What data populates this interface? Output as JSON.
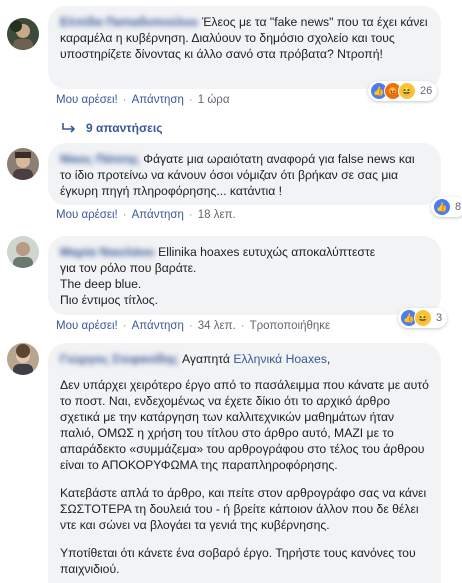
{
  "comments": [
    {
      "text": "Έλεος με τα \"fake news\" που τα έχει κάνει καραμέλα η κυβέρνηση. Διαλύουν το δημόσιο σχολείο και τους υποστηρίζετε δίνοντας κι άλλο σανό στα πρόβατα? Ντροπή!",
      "like": "Μου αρέσει!",
      "reply": "Απάντηση",
      "time": "1 ώρα",
      "reaction_count": "26",
      "replies_label": "9 απαντήσεις",
      "reactions": [
        "like",
        "angry",
        "haha"
      ]
    },
    {
      "text": "Φάγατε μια ωραιότατη αναφορά για false news και το ίδιο προτείνω να κάνουν όσοι νόμιζαν ότι βρήκαν σε σας μια έγκυρη πηγή πληροφόρησης... κατάντια !",
      "like": "Μου αρέσει!",
      "reply": "Απάντηση",
      "time": "18 λεπ.",
      "reaction_count": "8",
      "reactions": [
        "like"
      ]
    },
    {
      "text_lines": [
        "Ellinika hoaxes ευτυχώς αποκαλύπτεστε",
        "για τον ρόλο που βαράτε.",
        "The deep blue.",
        "Πιο έντιμος τίτλος."
      ],
      "like": "Μου αρέσει!",
      "reply": "Απάντηση",
      "time": "34 λεπ.",
      "edited": "Τροποποιήθηκε",
      "reaction_count": "3",
      "reactions": [
        "like",
        "haha"
      ]
    },
    {
      "greeting": "Αγαπητά",
      "mention": "Ελληνικά Hoaxes",
      "greeting_end": ",",
      "para1": "Δεν υπάρχει χειρότερο έργο από το πασάλειμμα που κάνατε με αυτό το ποστ. Ναι, ενδεχομένως να έχετε δίκιο ότι το αρχικό άρθρο σχετικά με την κατάργηση των καλλιτεχνικών μαθημάτων ήταν παλιό, ΟΜΩΣ η χρήση του τίτλου στο άρθρο αυτό, ΜΑΖΙ με το απαράδεκτο «συμμάζεμα» του αρθρογράφου στο τέλος του άρθρου είναι το ΑΠΟΚΟΡΥΦΩΜΑ της παραπληροφόρησης.",
      "para2": "Κατεβάστε απλά το άρθρο, και πείτε στον αρθρογράφο σας να κάνει ΣΩΣΤΟΤΕΡΑ τη δουλειά του - ή βρείτε κάποιον άλλον που δε θέλει ντε και σώνει να βλογάει τα γενιά της κυβέρνησης.",
      "para3": "Υποτίθεται ότι κάνετε ένα σοβαρό έργο. Τηρήστε τους κανόνες του παιχνιδιού."
    }
  ]
}
